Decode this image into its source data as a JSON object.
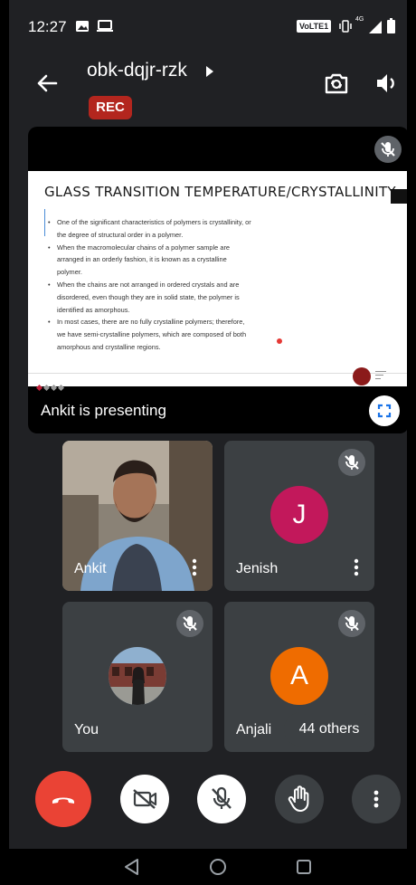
{
  "status_bar": {
    "time": "12:27",
    "network_badge": "VoLTE1",
    "network_type": "4G",
    "icons": [
      "image-icon",
      "laptop-icon",
      "vibrate-icon",
      "signal-icon",
      "battery-icon"
    ]
  },
  "header": {
    "meeting_code": "obk-dqjr-rzk",
    "recording_badge": "REC",
    "icons": [
      "back-arrow-icon",
      "caret-right-icon",
      "switch-camera-icon",
      "speaker-icon"
    ]
  },
  "presentation": {
    "presenter_label": "Ankit is presenting",
    "slide": {
      "title": "GLASS TRANSITION TEMPERATURE/CRYSTALLINITY",
      "bullets": [
        "One of the significant characteristics of polymers is crystallinity, or the degree of structural order in a polymer.",
        "When the macromolecular chains of a polymer sample are arranged in an orderly fashion, it is known as a crystalline polymer.",
        "When the chains are not arranged in ordered crystals and are disordered, even though they are in solid state, the polymer is identified as amorphous.",
        "In most cases, there are no fully crystalline polymers; therefore, we have semi-crystalline polymers, which are composed of both amorphous and crystalline regions."
      ]
    },
    "icons": [
      "mic-off-icon",
      "fullscreen-icon"
    ]
  },
  "participants": [
    {
      "name": "Ankit",
      "avatar": "video"
    },
    {
      "name": "Jenish",
      "avatar_letter": "J",
      "avatar_color": "#c2185b"
    },
    {
      "name": "You",
      "avatar": "photo"
    },
    {
      "name": "Anjali",
      "avatar_letter": "A",
      "avatar_color": "#ef6c00"
    }
  ],
  "others_badge": "44 others",
  "controls": {
    "icons": [
      "end-call-icon",
      "camera-off-icon",
      "mic-off-icon",
      "raise-hand-icon",
      "more-options-icon"
    ],
    "colors": {
      "end_call": "#ea4335",
      "button_light": "#ffffff",
      "button_dark": "#3c4043"
    }
  },
  "nav_bar": {
    "icons": [
      "back-triangle-icon",
      "home-circle-icon",
      "recents-square-icon"
    ]
  },
  "colors": {
    "background": "#202124",
    "tile": "#3c4043",
    "rec": "#b3261e"
  }
}
